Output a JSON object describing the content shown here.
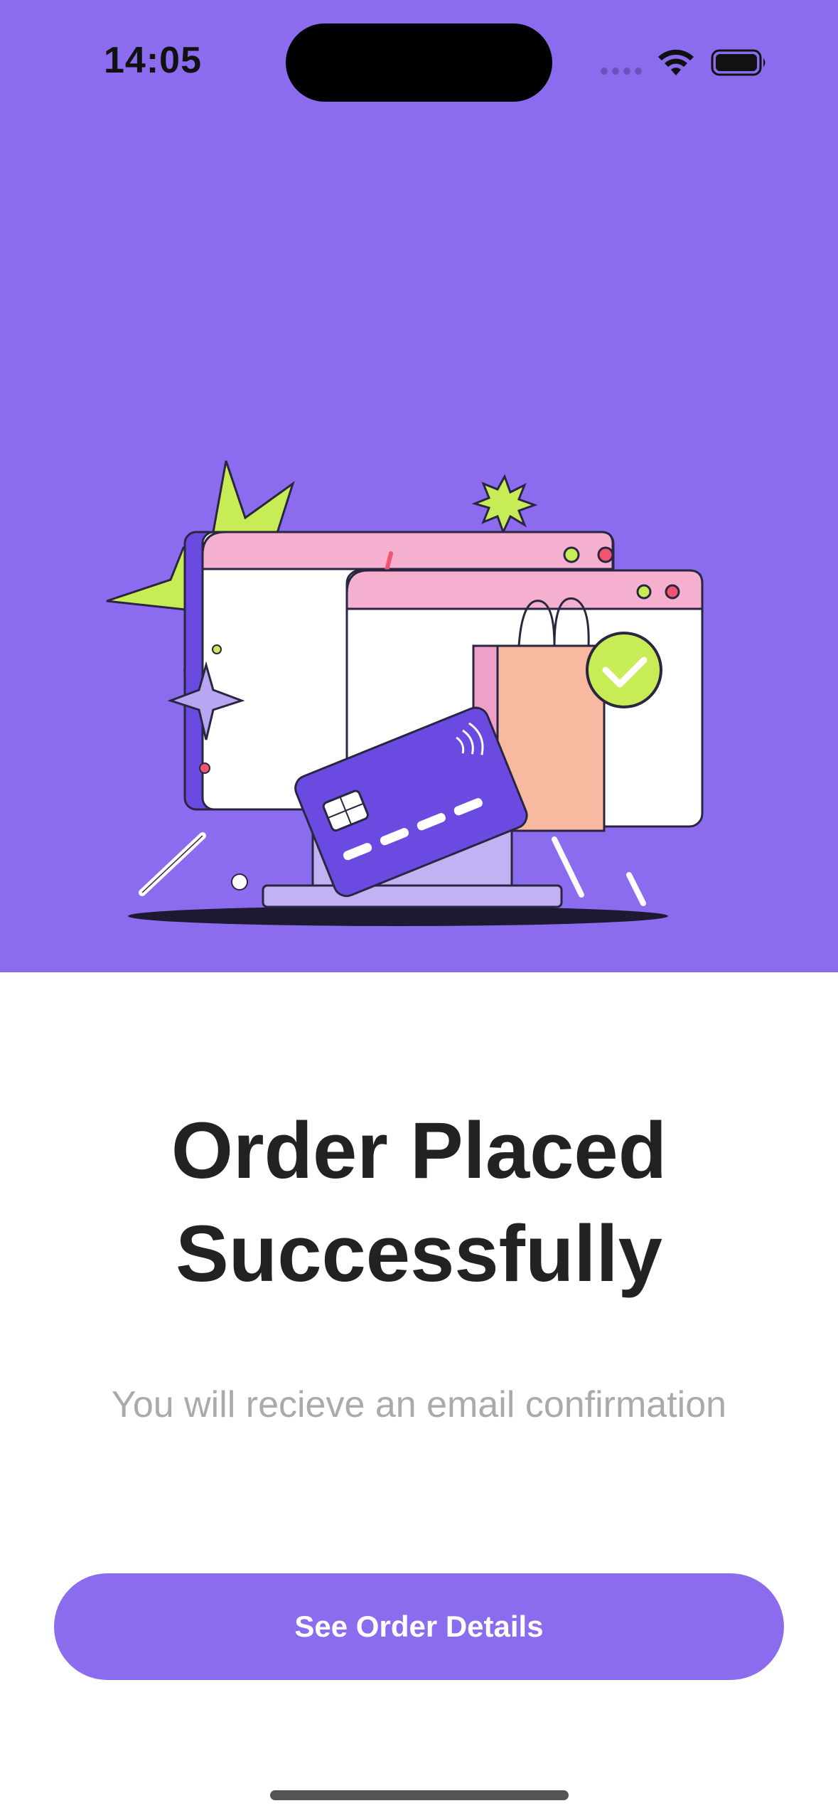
{
  "status_bar": {
    "time": "14:05",
    "icons": [
      "signal-icon",
      "wifi-icon",
      "battery-icon"
    ]
  },
  "hero": {
    "background_color": "#8b6cef",
    "illustration": "order-success-illustration"
  },
  "content": {
    "title": "Order Placed Successfully",
    "subtitle": "You will recieve an email confirmation"
  },
  "actions": {
    "primary_label": "See Order Details",
    "primary_color": "#8b6cef"
  }
}
